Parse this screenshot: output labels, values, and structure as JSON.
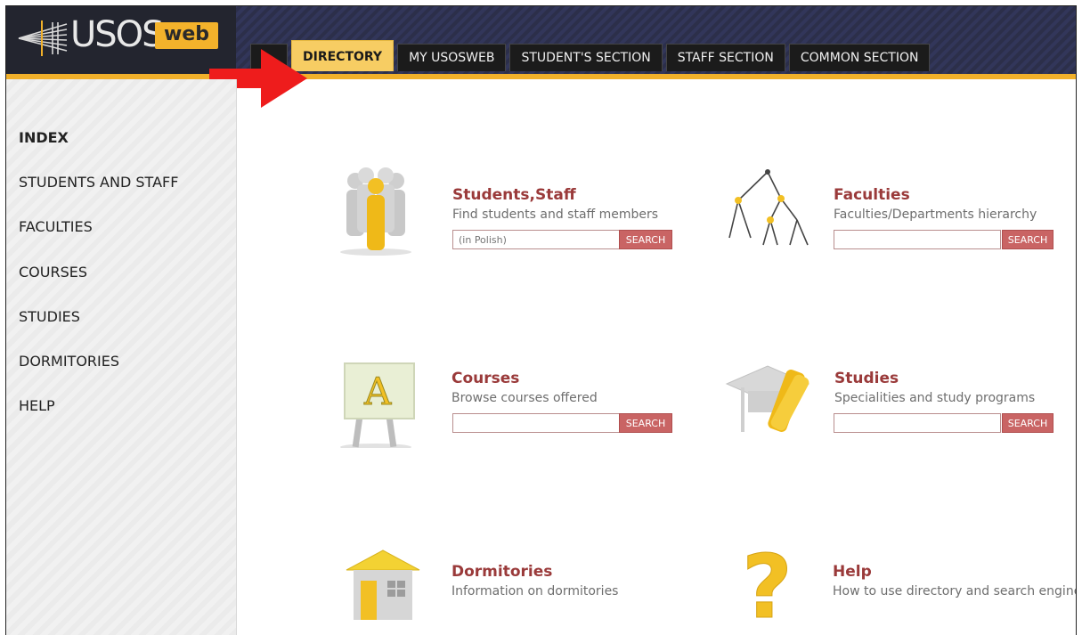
{
  "logo": {
    "text_usos": "USOS",
    "text_web": "web"
  },
  "tabs": [
    {
      "label": ""
    },
    {
      "label": "DIRECTORY"
    },
    {
      "label": "MY USOSWEB"
    },
    {
      "label": "STUDENT'S SECTION"
    },
    {
      "label": "STAFF SECTION"
    },
    {
      "label": "COMMON SECTION"
    }
  ],
  "sidebar": {
    "items": [
      {
        "label": "INDEX"
      },
      {
        "label": "STUDENTS AND STAFF"
      },
      {
        "label": "FACULTIES"
      },
      {
        "label": "COURSES"
      },
      {
        "label": "STUDIES"
      },
      {
        "label": "DORMITORIES"
      },
      {
        "label": "HELP"
      }
    ]
  },
  "sections": {
    "students": {
      "title": "Students,Staff",
      "desc": "Find students and staff members",
      "placeholder": "(in Polish)",
      "button": "SEARCH"
    },
    "faculties": {
      "title": "Faculties",
      "desc": "Faculties/Departments hierarchy",
      "placeholder": "",
      "button": "SEARCH"
    },
    "courses": {
      "title": "Courses",
      "desc": "Browse courses offered",
      "placeholder": "",
      "button": "SEARCH"
    },
    "studies": {
      "title": "Studies",
      "desc": "Specialities and study programs",
      "placeholder": "",
      "button": "SEARCH"
    },
    "dormitories": {
      "title": "Dormitories",
      "desc": "Information on dormitories"
    },
    "help": {
      "title": "Help",
      "desc": "How to use directory and search engines"
    }
  },
  "colors": {
    "accent": "#f1b02a",
    "title": "#9a3a3a",
    "search_button": "#c96464",
    "arrow": "#ee1c1c"
  }
}
